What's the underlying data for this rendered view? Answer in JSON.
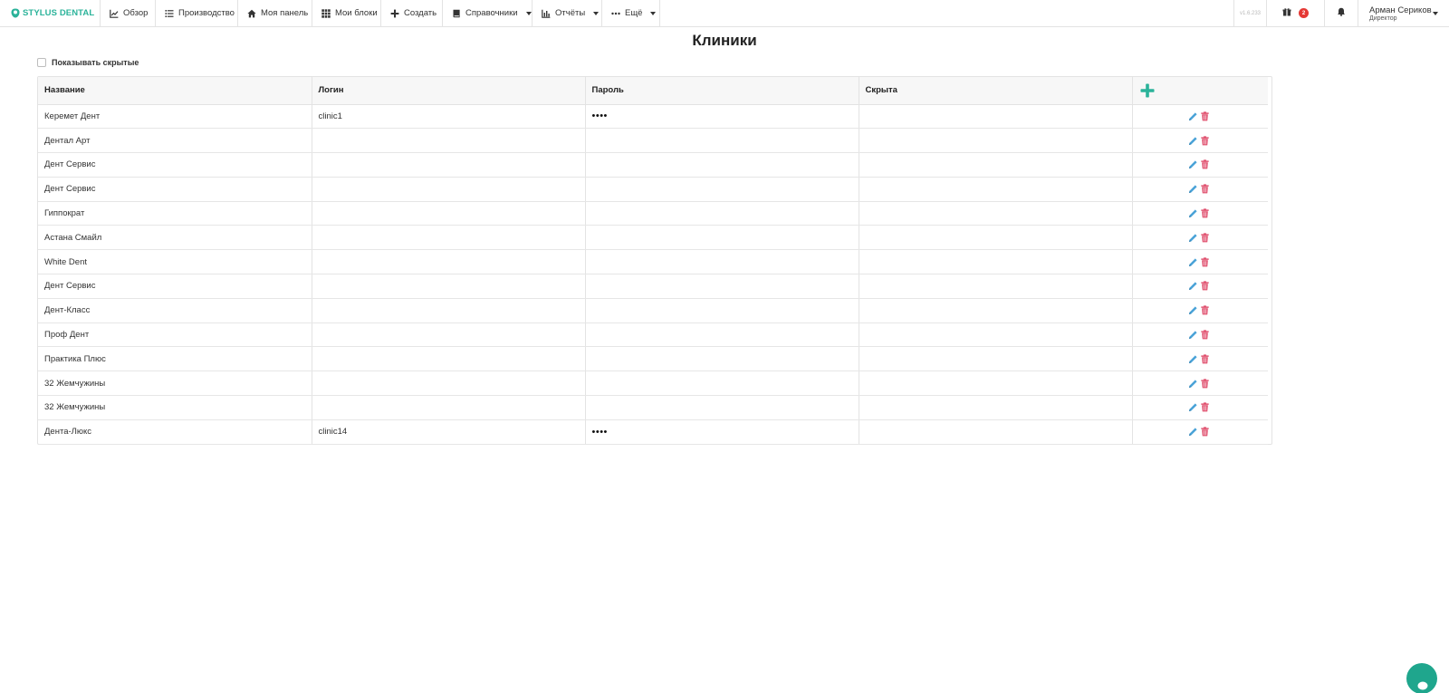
{
  "brand": {
    "name": "STYLUS DENTAL",
    "icon": "tooth-icon",
    "color": "#2bb39a"
  },
  "nav": [
    {
      "label": "Обзор",
      "icon": "chart-line-icon",
      "dropdown": false
    },
    {
      "label": "Производство",
      "icon": "list-icon",
      "dropdown": false
    },
    {
      "label": "Моя панель",
      "icon": "home-icon",
      "dropdown": false
    },
    {
      "label": "Мои блоки",
      "icon": "grid-icon",
      "dropdown": false
    },
    {
      "label": "Создать",
      "icon": "plus-icon",
      "dropdown": false
    },
    {
      "label": "Справочники",
      "icon": "book-icon",
      "dropdown": true
    },
    {
      "label": "Отчёты",
      "icon": "bar-chart-icon",
      "dropdown": true
    },
    {
      "label": "Ещё",
      "icon": "ellipsis-icon",
      "dropdown": true
    }
  ],
  "header_right": {
    "version": "v1.6.233",
    "gift_badge": "2",
    "user_name": "Арман Сериков",
    "user_role": "Директор"
  },
  "page": {
    "title": "Клиники",
    "show_hidden_label": "Показывать скрытые",
    "show_hidden_checked": false
  },
  "table": {
    "columns": [
      "Название",
      "Логин",
      "Пароль",
      "Скрыта"
    ],
    "rows": [
      {
        "name": "Керемет Дент",
        "login": "clinic1",
        "password": "••••",
        "hidden": ""
      },
      {
        "name": "Дентал Арт",
        "login": "",
        "password": "",
        "hidden": ""
      },
      {
        "name": "Дент Сервис",
        "login": "",
        "password": "",
        "hidden": ""
      },
      {
        "name": "Дент Сервис",
        "login": "",
        "password": "",
        "hidden": ""
      },
      {
        "name": "Гиппократ",
        "login": "",
        "password": "",
        "hidden": ""
      },
      {
        "name": "Астана Смайл",
        "login": "",
        "password": "",
        "hidden": ""
      },
      {
        "name": "White Dent",
        "login": "",
        "password": "",
        "hidden": ""
      },
      {
        "name": "Дент Сервис",
        "login": "",
        "password": "",
        "hidden": ""
      },
      {
        "name": "Дент-Класс",
        "login": "",
        "password": "",
        "hidden": ""
      },
      {
        "name": "Проф Дент",
        "login": "",
        "password": "",
        "hidden": ""
      },
      {
        "name": "Практика Плюс",
        "login": "",
        "password": "",
        "hidden": ""
      },
      {
        "name": "32 Жемчужины",
        "login": "",
        "password": "",
        "hidden": ""
      },
      {
        "name": "32 Жемчужины",
        "login": "",
        "password": "",
        "hidden": ""
      },
      {
        "name": "Дента-Люкс",
        "login": "clinic14",
        "password": "••••",
        "hidden": ""
      }
    ]
  },
  "colors": {
    "accent": "#2bb39a",
    "edit": "#4aa3d8",
    "delete": "#e0506e",
    "badge": "#e53935",
    "chat": "#1fa68d"
  }
}
